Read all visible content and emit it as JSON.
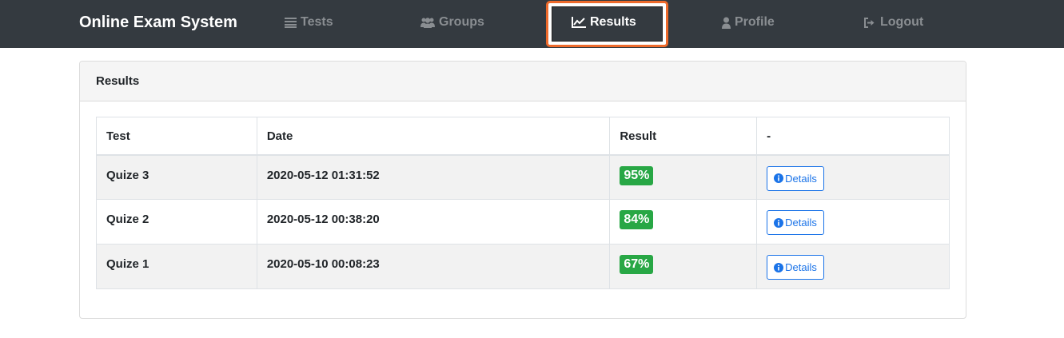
{
  "navbar": {
    "brand": "Online Exam System",
    "items": [
      {
        "label": "Tests",
        "icon": "list-icon"
      },
      {
        "label": "Groups",
        "icon": "users-icon"
      },
      {
        "label": "Results",
        "icon": "line-chart-icon",
        "active": true
      },
      {
        "label": "Profile",
        "icon": "user-icon"
      },
      {
        "label": "Logout",
        "icon": "logout-icon"
      }
    ]
  },
  "card": {
    "title": "Results"
  },
  "table": {
    "headers": [
      "Test",
      "Date",
      "Result",
      "-"
    ],
    "rows": [
      {
        "test": "Quize 3",
        "date": "2020-05-12 01:31:52",
        "result": "95%",
        "action": "Details"
      },
      {
        "test": "Quize 2",
        "date": "2020-05-12 00:38:20",
        "result": "84%",
        "action": "Details"
      },
      {
        "test": "Quize 1",
        "date": "2020-05-10 00:08:23",
        "result": "67%",
        "action": "Details"
      }
    ]
  },
  "colors": {
    "navbar_bg": "#343a40",
    "highlight": "#ee6a2b",
    "badge_success": "#28a745",
    "link_blue": "#1a73e8"
  }
}
